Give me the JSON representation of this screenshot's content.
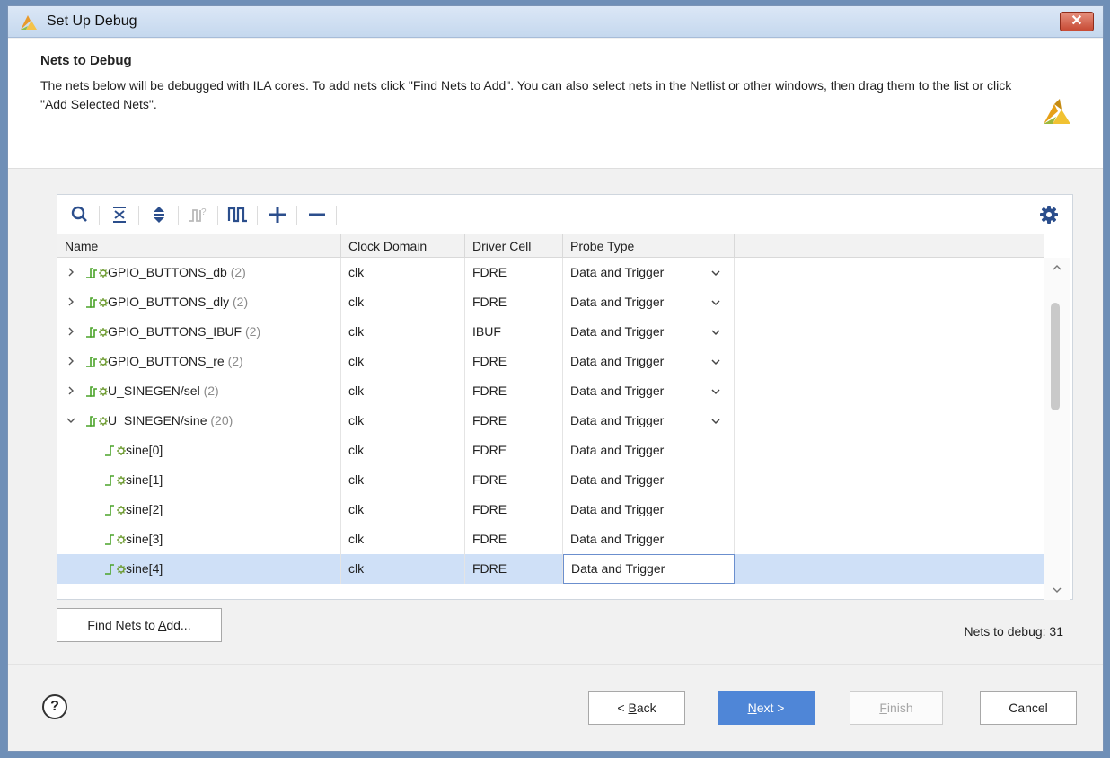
{
  "window": {
    "title": "Set Up Debug",
    "close_label": "✕"
  },
  "header": {
    "title": "Nets to Debug",
    "description": "The nets below will be debugged with ILA cores. To add nets click \"Find Nets to Add\". You can also select nets in the Netlist or other windows, then drag them to the list or click \"Add Selected Nets\"."
  },
  "toolbar": {
    "icons": [
      "search-icon",
      "collapse-all-icon",
      "expand-all-icon",
      "schematic-icon",
      "waveform-icon",
      "add-icon",
      "remove-icon",
      "gear-icon"
    ]
  },
  "table": {
    "columns": [
      "Name",
      "Clock Domain",
      "Driver Cell",
      "Probe Type"
    ],
    "rows": [
      {
        "name": "GPIO_BUTTONS_db",
        "count": "(2)",
        "clock": "clk",
        "driver": "FDRE",
        "probe": "Data and Trigger",
        "expander": "collapsed",
        "dropdown": true
      },
      {
        "name": "GPIO_BUTTONS_dly",
        "count": "(2)",
        "clock": "clk",
        "driver": "FDRE",
        "probe": "Data and Trigger",
        "expander": "collapsed",
        "dropdown": true
      },
      {
        "name": "GPIO_BUTTONS_IBUF",
        "count": "(2)",
        "clock": "clk",
        "driver": "IBUF",
        "probe": "Data and Trigger",
        "expander": "collapsed",
        "dropdown": true
      },
      {
        "name": "GPIO_BUTTONS_re",
        "count": "(2)",
        "clock": "clk",
        "driver": "FDRE",
        "probe": "Data and Trigger",
        "expander": "collapsed",
        "dropdown": true
      },
      {
        "name": "U_SINEGEN/sel",
        "count": "(2)",
        "clock": "clk",
        "driver": "FDRE",
        "probe": "Data and Trigger",
        "expander": "collapsed",
        "dropdown": true
      },
      {
        "name": "U_SINEGEN/sine",
        "count": "(20)",
        "clock": "clk",
        "driver": "FDRE",
        "probe": "Data and Trigger",
        "expander": "expanded",
        "dropdown": true
      },
      {
        "name": "sine[0]",
        "count": "",
        "clock": "clk",
        "driver": "FDRE",
        "probe": "Data and Trigger",
        "expander": "none",
        "dropdown": false
      },
      {
        "name": "sine[1]",
        "count": "",
        "clock": "clk",
        "driver": "FDRE",
        "probe": "Data and Trigger",
        "expander": "none",
        "dropdown": false
      },
      {
        "name": "sine[2]",
        "count": "",
        "clock": "clk",
        "driver": "FDRE",
        "probe": "Data and Trigger",
        "expander": "none",
        "dropdown": false
      },
      {
        "name": "sine[3]",
        "count": "",
        "clock": "clk",
        "driver": "FDRE",
        "probe": "Data and Trigger",
        "expander": "none",
        "dropdown": false
      },
      {
        "name": "sine[4]",
        "count": "",
        "clock": "clk",
        "driver": "FDRE",
        "probe": "Data and Trigger",
        "expander": "none",
        "dropdown": false,
        "selected": true
      }
    ]
  },
  "find_nets_button": {
    "prefix": "Find Nets to ",
    "mnemonic": "A",
    "suffix": "dd..."
  },
  "nets_count": "Nets to debug: 31",
  "footer": {
    "help_label": "?",
    "back": {
      "prefix": "< ",
      "mnemonic": "B",
      "suffix": "ack"
    },
    "next": {
      "prefix": "",
      "mnemonic": "N",
      "suffix": "ext >"
    },
    "finish": {
      "prefix": "",
      "mnemonic": "F",
      "suffix": "inish"
    },
    "cancel": "Cancel"
  },
  "colors": {
    "accent": "#4f86d7",
    "selection": "#cfe0f7",
    "net_icon": "#4aa329"
  }
}
